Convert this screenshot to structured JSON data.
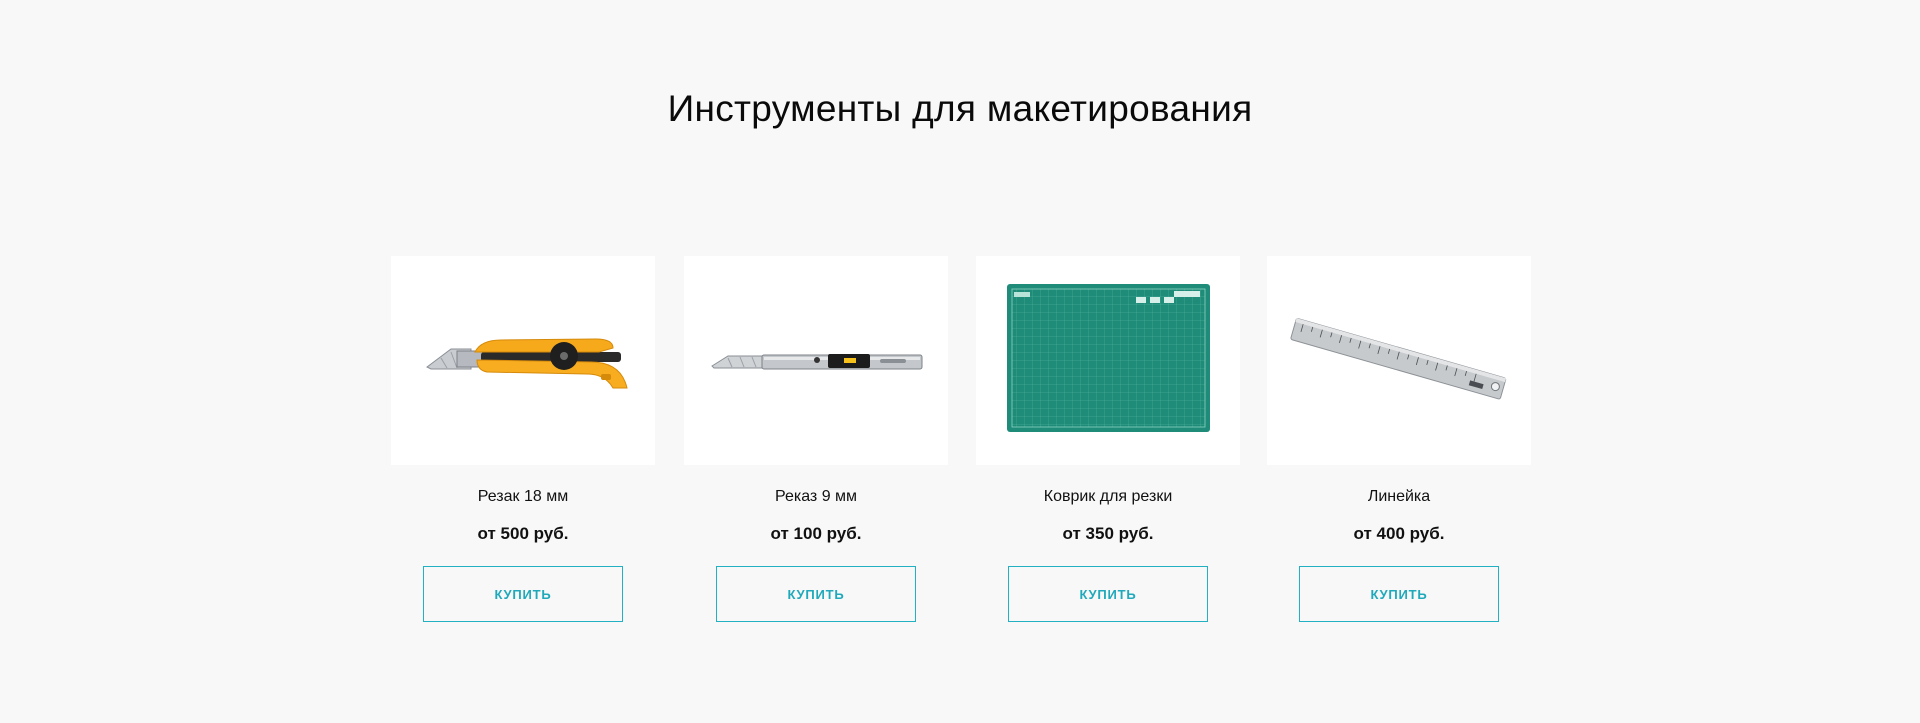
{
  "section": {
    "title": "Инструменты для макетирования"
  },
  "products": [
    {
      "name": "Резак 18 мм",
      "price": "от 500 руб.",
      "button_label": "КУПИТЬ",
      "icon": "utility-knife-18mm"
    },
    {
      "name": "Реказ 9 мм",
      "price": "от 100 руб.",
      "button_label": "КУПИТЬ",
      "icon": "snap-off-knife-9mm"
    },
    {
      "name": "Коврик для резки",
      "price": "от 350 руб.",
      "button_label": "КУПИТЬ",
      "icon": "cutting-mat"
    },
    {
      "name": "Линейка",
      "price": "от 400 руб.",
      "button_label": "КУПИТЬ",
      "icon": "steel-ruler"
    }
  ],
  "colors": {
    "background": "#f8f8f8",
    "accent": "#21b1c3",
    "card_background": "#ffffff"
  }
}
